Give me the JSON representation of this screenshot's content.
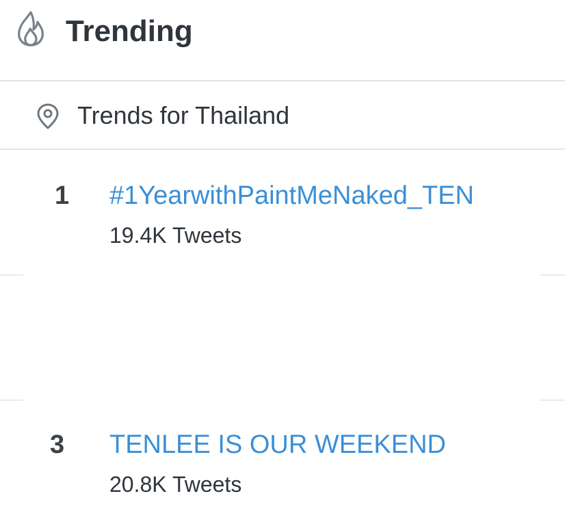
{
  "header": {
    "icon": "flame-icon",
    "title": "Trending"
  },
  "location": {
    "icon": "map-pin-icon",
    "label": "Trends for Thailand"
  },
  "trends": [
    {
      "rank": "1",
      "name": "#1YearwithPaintMeNaked_TEN",
      "count": "19.4K Tweets"
    },
    {
      "rank": "3",
      "name": "TENLEE IS OUR WEEKEND",
      "count": "20.8K Tweets"
    }
  ],
  "colors": {
    "link": "#3b8fd6",
    "text": "#2f353b",
    "divider": "#e3e6e9"
  }
}
